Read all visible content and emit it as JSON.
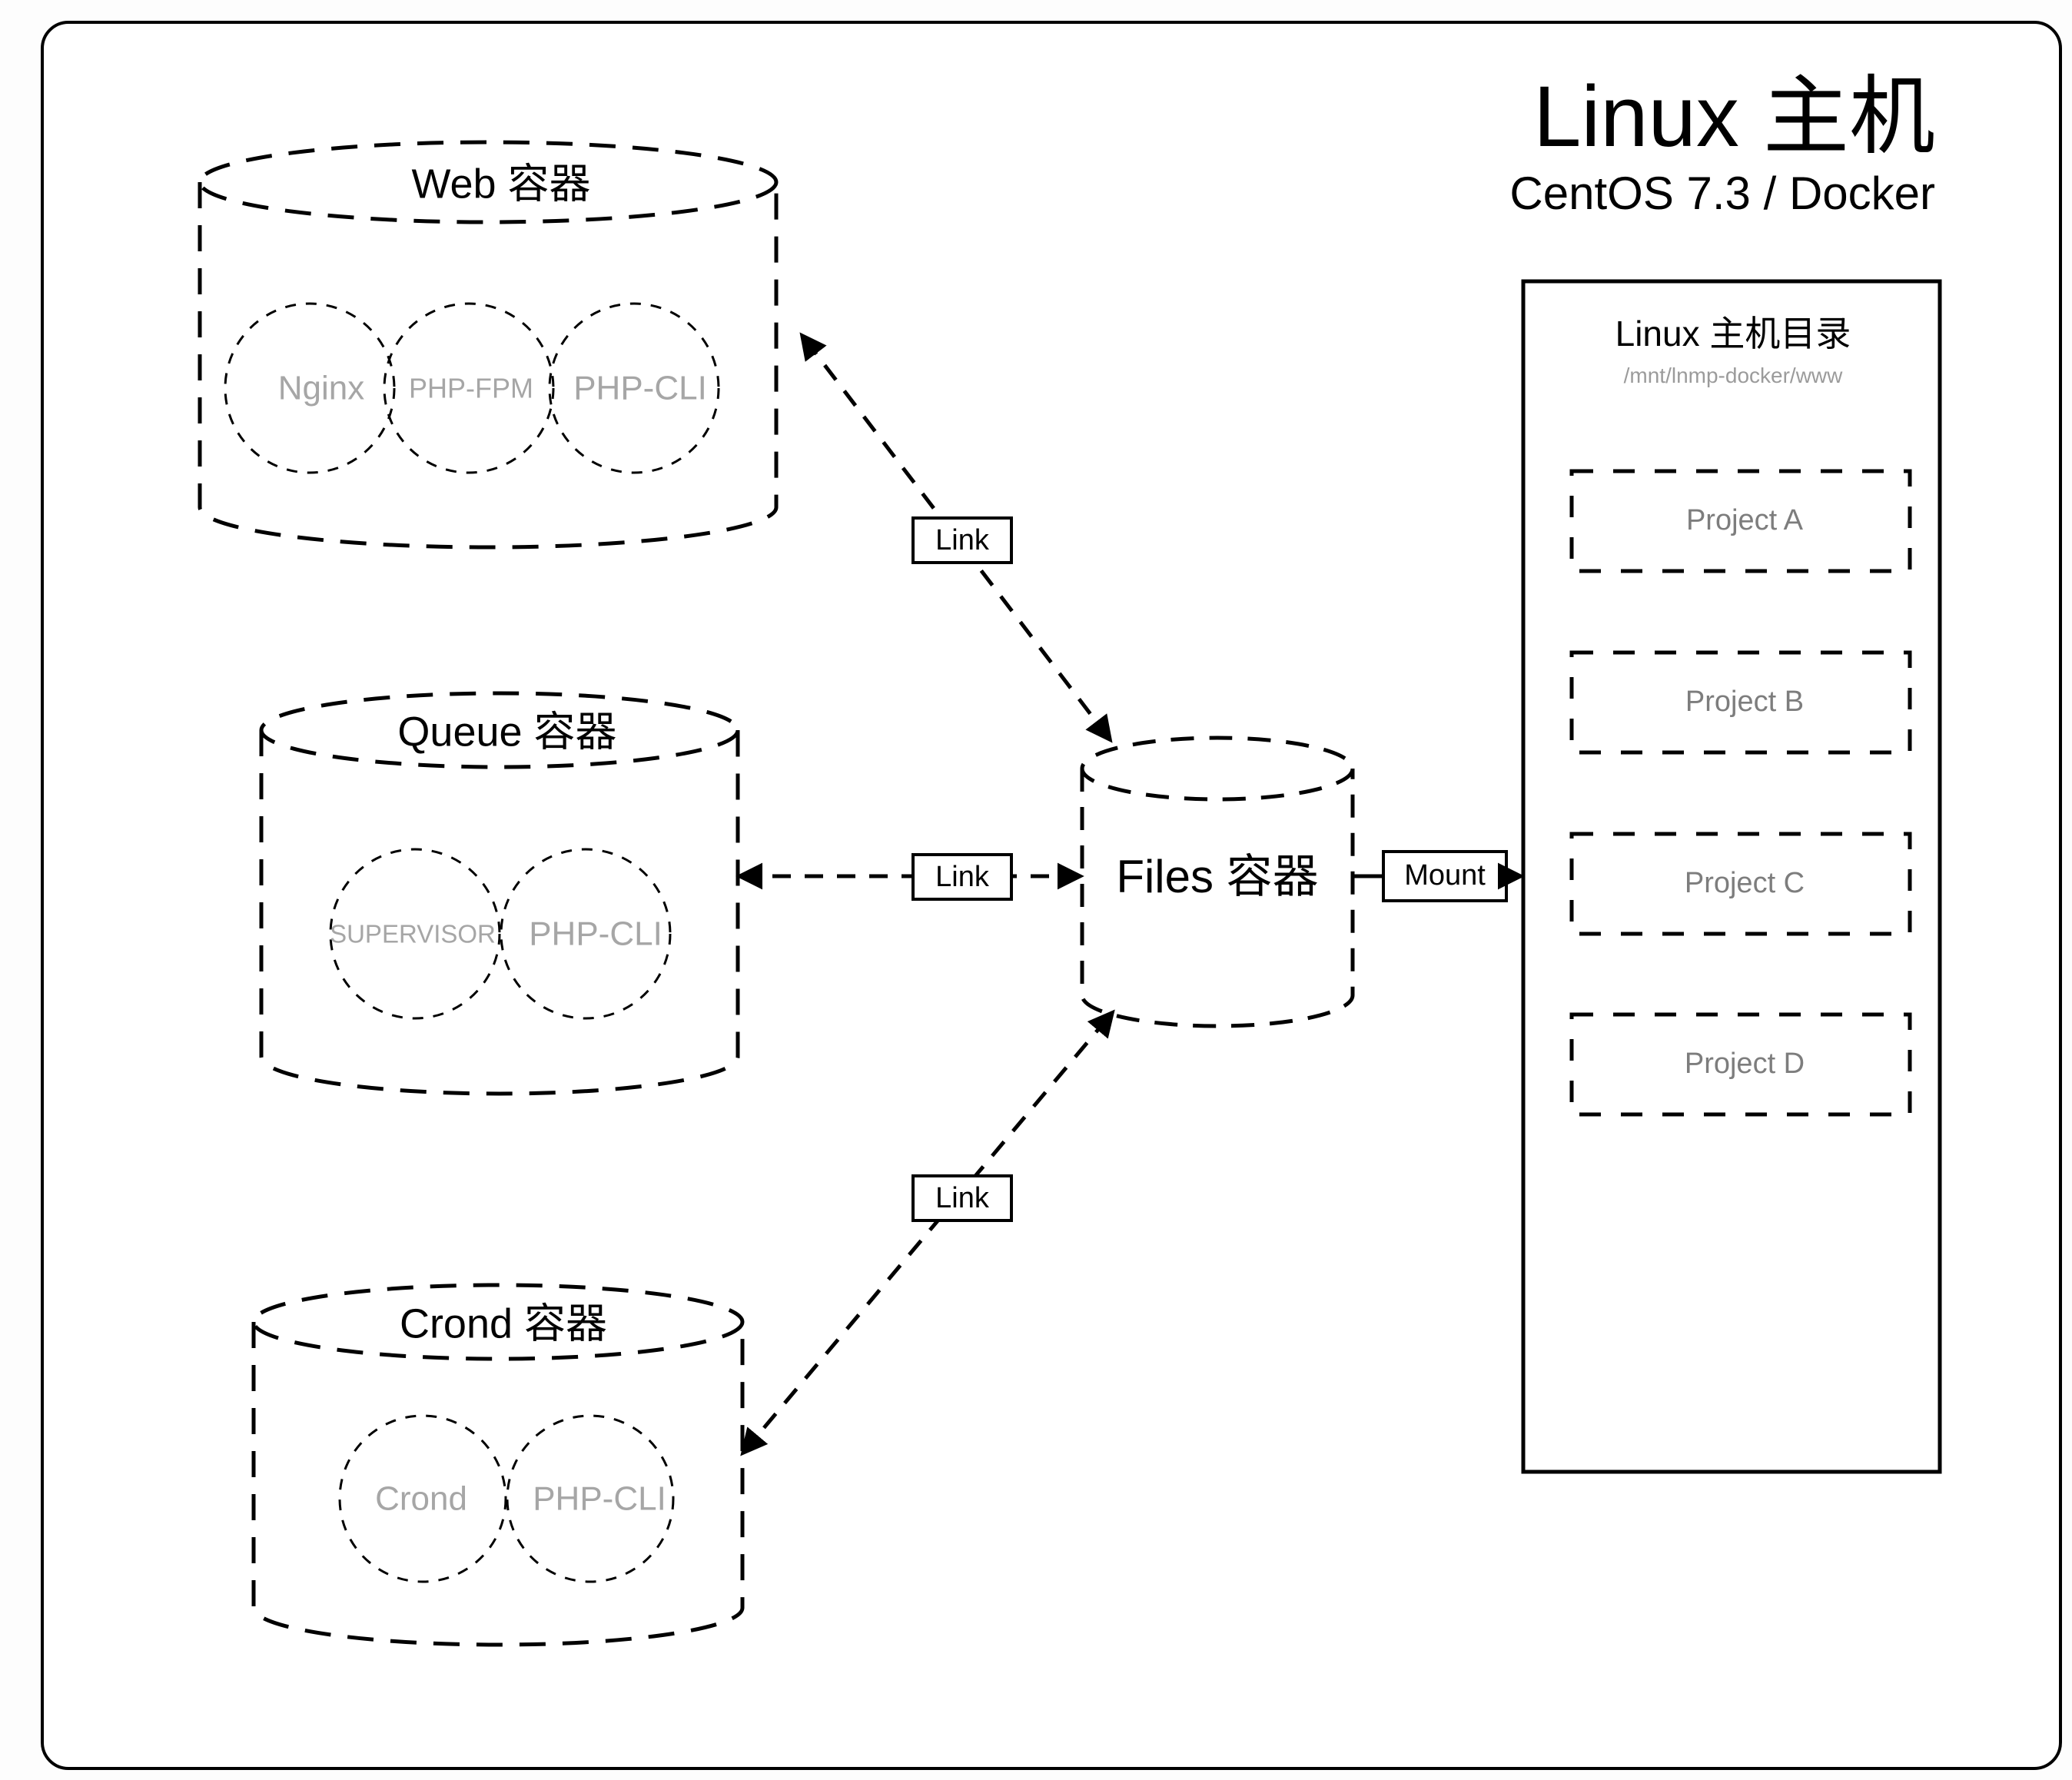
{
  "host": {
    "title": "Linux 主机",
    "subtitle": "CentOS 7.3 / Docker"
  },
  "containers": [
    {
      "id": "web",
      "title": "Web 容器",
      "services": [
        "Nginx",
        "PHP-FPM",
        "PHP-CLI"
      ]
    },
    {
      "id": "queue",
      "title": "Queue 容器",
      "services": [
        "SUPERVISOR",
        "PHP-CLI"
      ]
    },
    {
      "id": "crond",
      "title": "Crond 容器",
      "services": [
        "Crond",
        "PHP-CLI"
      ]
    }
  ],
  "files_container": {
    "title": "Files 容器"
  },
  "host_directory": {
    "title": "Linux 主机目录",
    "path": "/mnt/lnmp-docker/www",
    "projects": [
      "Project A",
      "Project B",
      "Project C",
      "Project D"
    ]
  },
  "edges": {
    "link_web": "Link",
    "link_queue": "Link",
    "link_crond": "Link",
    "mount": "Mount"
  },
  "colors": {
    "stroke": "#000000",
    "service_text": "#a6a6a6",
    "project_text": "#7d7d7d",
    "path_text": "#9b9b9b",
    "background": "#ffffff"
  }
}
